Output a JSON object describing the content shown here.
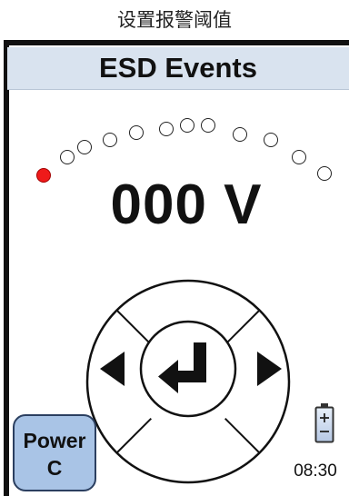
{
  "caption": "设置报警阈值",
  "header": {
    "title": "ESD Events"
  },
  "meter": {
    "value_text": "000 V",
    "level_leds": 12,
    "lit_leds": 1,
    "lit_color": "#ef1a1a"
  },
  "controls": {
    "left": "left-arrow",
    "right": "right-arrow",
    "enter": "enter-icon"
  },
  "power_button": {
    "line1": "Power",
    "line2": "C"
  },
  "status": {
    "battery": "battery-icon",
    "time": "08:30"
  }
}
